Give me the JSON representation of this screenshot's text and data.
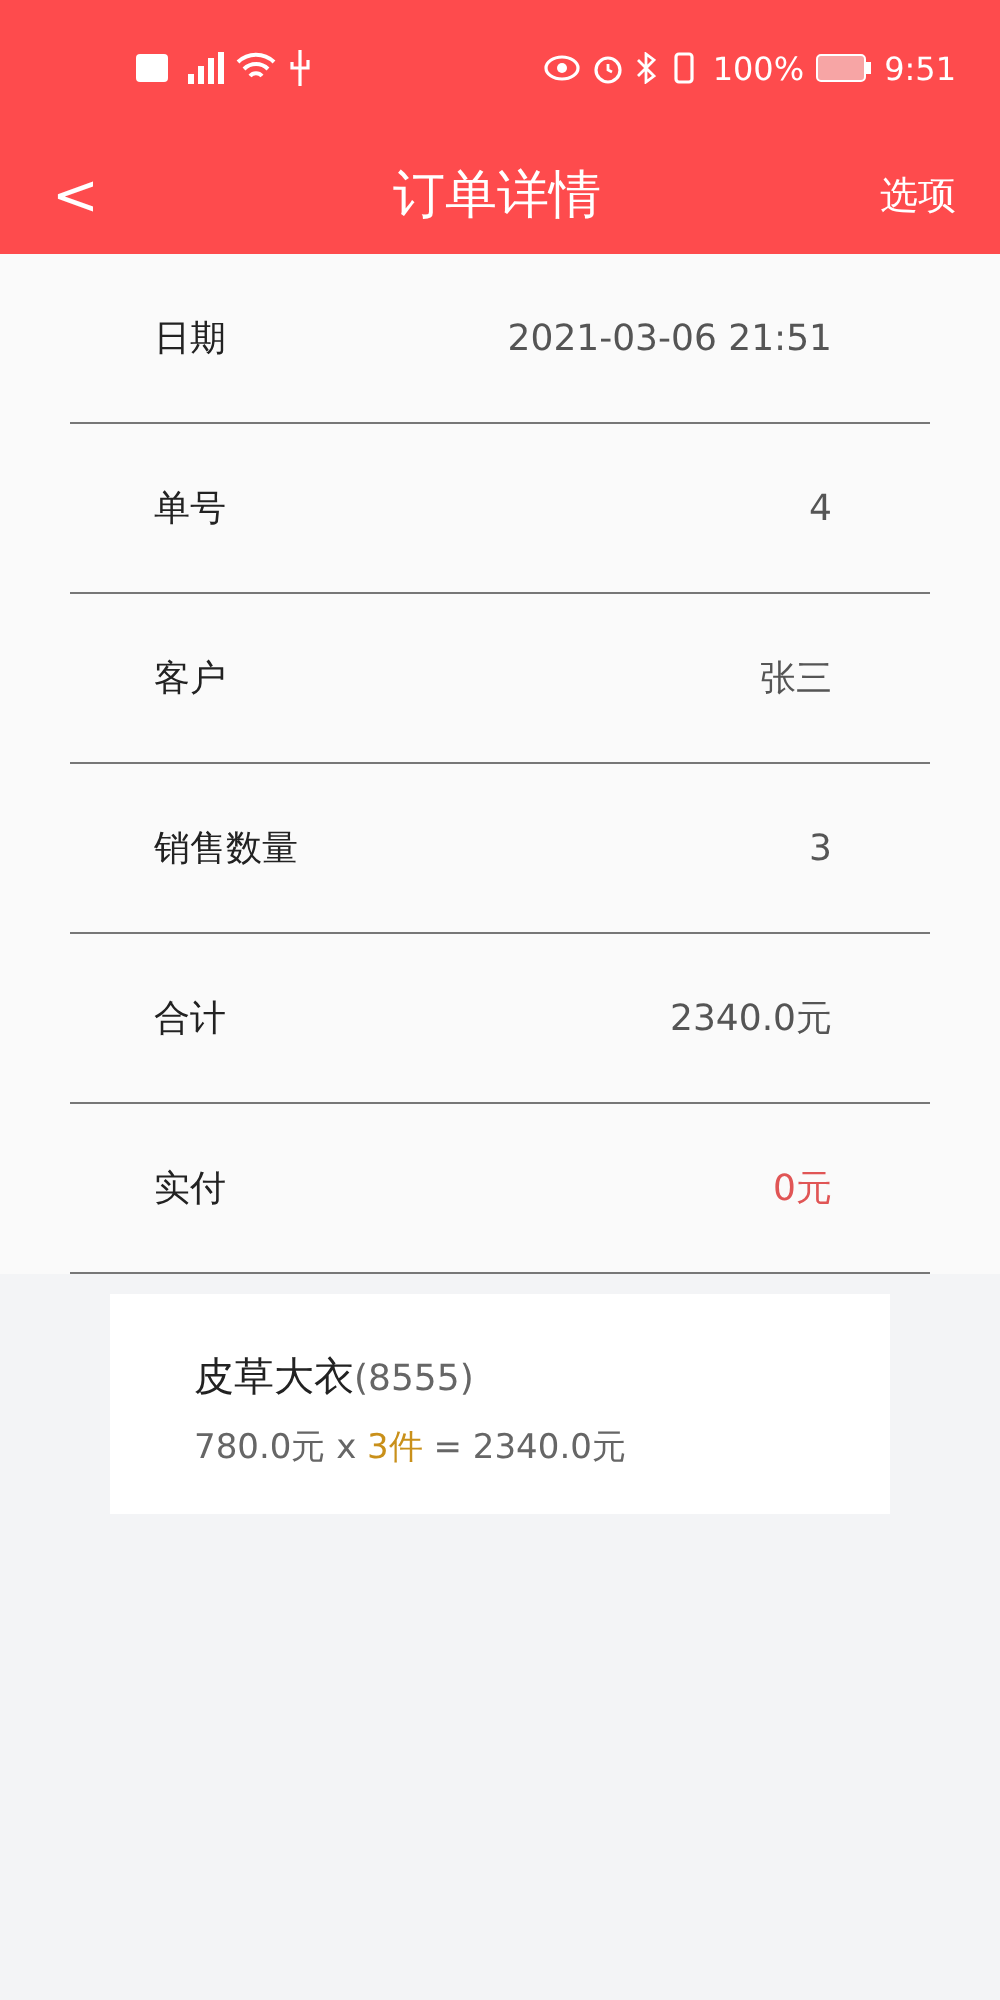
{
  "status_bar": {
    "battery": "100%",
    "time": "9:51"
  },
  "header": {
    "back": "<",
    "title": "订单详情",
    "action": "选项"
  },
  "rows": [
    {
      "label": "日期",
      "value": "2021-03-06 21:51",
      "color": "#555555"
    },
    {
      "label": "单号",
      "value": "4",
      "color": "#555555"
    },
    {
      "label": "客户",
      "value": "张三",
      "color": "#555555"
    },
    {
      "label": "销售数量",
      "value": "3",
      "color": "#555555"
    },
    {
      "label": "合计",
      "value": "2340.0元",
      "color": "#555555"
    },
    {
      "label": "实付",
      "value": "0元",
      "color": "#e05555"
    }
  ],
  "items": [
    {
      "name": "皮草大衣",
      "code": "(8555)",
      "unit_price": "780.0元",
      "times": "x",
      "quantity": "3件",
      "total": "= 2340.0元"
    }
  ]
}
